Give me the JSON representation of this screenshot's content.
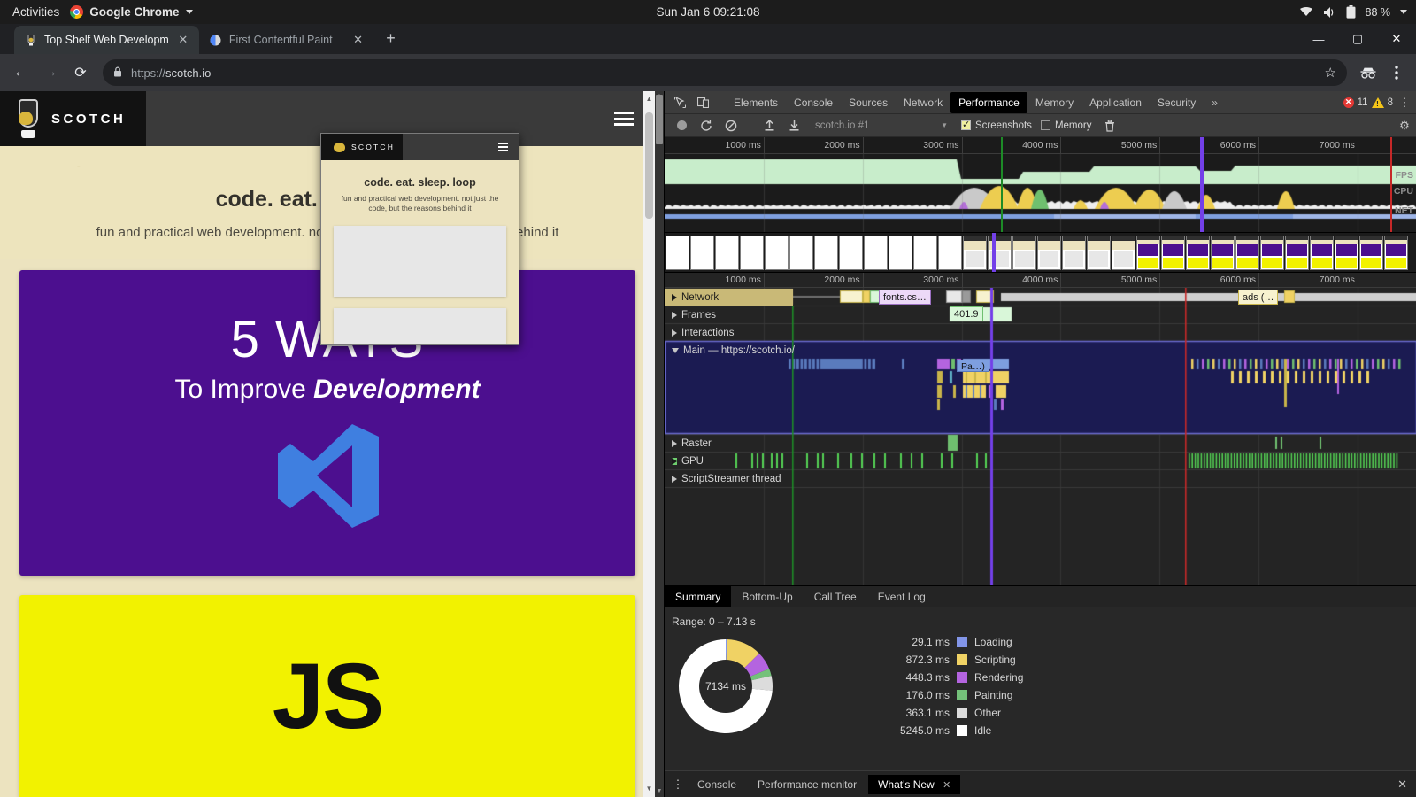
{
  "os": {
    "activities": "Activities",
    "app_name": "Google Chrome",
    "clock": "Sun Jan 6  09:21:08",
    "battery": "88 %"
  },
  "browser": {
    "tabs": [
      {
        "title": "Top Shelf Web Developm",
        "favicon": "scotch-glass-icon",
        "active": true,
        "close": "✕"
      },
      {
        "title": "First Contentful Paint",
        "favicon": "lighthouse-icon",
        "active": false,
        "close": "✕"
      }
    ],
    "new_tab_label": "+",
    "window_controls": {
      "minimize": "—",
      "maximize": "▢",
      "close": "✕"
    },
    "nav": {
      "back": "←",
      "forward": "→",
      "reload": "⟳"
    },
    "url_scheme": "https://",
    "url_host": "scotch.io",
    "lock_icon": "lock-icon",
    "bookmark_icon": "star-icon",
    "incognito_icon": "incognito-icon",
    "menu_icon": "kebab-menu-icon"
  },
  "page": {
    "brand": "SCOTCH",
    "menu_icon": "hamburger-icon",
    "headline": "code. eat. sleep. loop",
    "subhead": "fun and practical web development. not just the code, but the reasons behind it",
    "card1": {
      "line1": "5 WAYS",
      "line2_prefix": "To Improve ",
      "line2_bold": "Development",
      "logo": "visual-studio-icon"
    },
    "card2": {
      "text": "JS"
    }
  },
  "devtools": {
    "panel_tabs": [
      "Elements",
      "Console",
      "Sources",
      "Network",
      "Performance",
      "Memory",
      "Application",
      "Security"
    ],
    "active_panel": "Performance",
    "overflow": "»",
    "errors": "11",
    "warnings": "8",
    "more_icon": "kebab-menu-icon",
    "inspect_icon": "inspect-element-icon",
    "device_icon": "device-toolbar-icon",
    "settings_icon": "gear-icon",
    "controls": {
      "record": "record-button",
      "reload_record": "reload-and-record-button",
      "clear": "clear-button",
      "load_profile": "load-profile-button",
      "save_profile": "save-profile-button",
      "profile_select": "scotch.io #1",
      "screenshots_label": "Screenshots",
      "screenshots_checked": true,
      "memory_label": "Memory",
      "memory_checked": false,
      "trash_icon": "trash-icon"
    },
    "overview": {
      "ticks": [
        "1000 ms",
        "2000 ms",
        "3000 ms",
        "4000 ms",
        "5000 ms",
        "6000 ms",
        "7000 ms"
      ],
      "lane_labels": [
        "FPS",
        "CPU",
        "NET"
      ]
    },
    "ruler2_ticks": [
      "1000 ms",
      "2000 ms",
      "3000 ms",
      "4000 ms",
      "5000 ms",
      "6000 ms",
      "7000 ms"
    ],
    "tracks": [
      {
        "name": "Network",
        "expanded": false
      },
      {
        "name": "Frames",
        "expanded": false
      },
      {
        "name": "Interactions",
        "expanded": false
      },
      {
        "name": "Main — https://scotch.io/",
        "expanded": true
      },
      {
        "name": "Raster",
        "expanded": false
      },
      {
        "name": "GPU",
        "expanded": false
      },
      {
        "name": "ScriptStreamer thread",
        "expanded": false
      }
    ],
    "events": {
      "fonts_request": "fonts.cs…",
      "ads_request": "ads (…",
      "frame_duration": "401.9",
      "paint_event": "Pa…)"
    },
    "detail_tabs": [
      "Summary",
      "Bottom-Up",
      "Call Tree",
      "Event Log"
    ],
    "active_detail_tab": "Summary",
    "range": "Range: 0 – 7.13 s",
    "donut_center": "7134 ms",
    "drawer": {
      "more_icon": "kebab-menu-icon",
      "tabs": [
        "Console",
        "Performance monitor",
        "What's New"
      ],
      "active_tab": "What's New",
      "tab_close": "✕",
      "drawer_close": "✕"
    },
    "screenshot_popup": {
      "brand": "SCOTCH",
      "headline": "code. eat. sleep. loop",
      "subhead": "fun and practical web development. not just the code, but the reasons behind it",
      "menu_icon": "hamburger-icon"
    }
  },
  "chart_data": {
    "type": "pie",
    "title": "Range: 0 – 7.13 s",
    "center_label": "7134 ms",
    "total_ms": 7134,
    "categories": [
      "Loading",
      "Scripting",
      "Rendering",
      "Painting",
      "Other",
      "Idle"
    ],
    "values": [
      29.1,
      872.3,
      448.3,
      176.0,
      363.1,
      5245.0
    ],
    "value_labels": [
      "29.1 ms",
      "872.3 ms",
      "448.3 ms",
      "176.0 ms",
      "363.1 ms",
      "5245.0 ms"
    ],
    "colors": [
      "#8295e8",
      "#f0d264",
      "#b464e0",
      "#74c17a",
      "#dcdcdc",
      "#ffffff"
    ],
    "legend_position": "right",
    "units": "ms"
  }
}
